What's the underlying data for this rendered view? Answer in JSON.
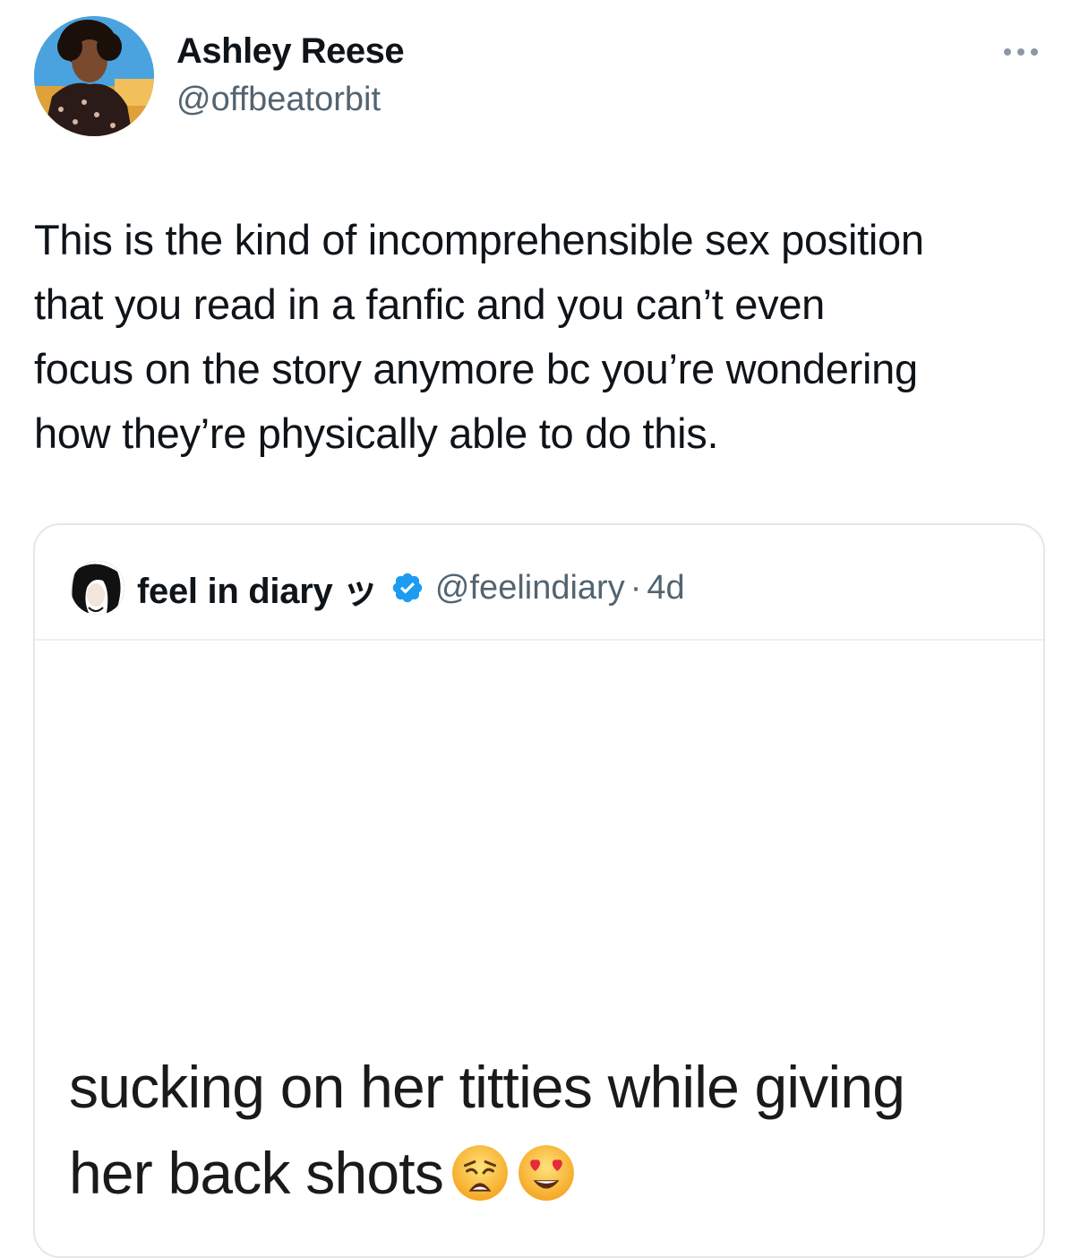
{
  "tweet": {
    "author": {
      "display_name": "Ashley Reese",
      "handle": "@offbeatorbit",
      "avatar_icon": "profile-photo"
    },
    "more_icon": "more-horizontal-icon",
    "text": "This is the kind of incomprehensible sex position\nthat you read in a fanfic and you can’t even\nfocus on the story anymore bc you’re wondering\nhow they’re physically able to do this."
  },
  "quoted": {
    "author": {
      "display_name": "feel in diary ッ",
      "handle": "@feelindiary",
      "separator": "·",
      "time": "4d",
      "verified_icon": "verified-badge-icon",
      "verified_color": "#1d9bf0"
    },
    "media_text": "sucking on her titties while giving\nher back shots",
    "emojis": [
      "weary-face-emoji",
      "heart-eyes-emoji"
    ]
  },
  "colors": {
    "text_primary": "#0f1419",
    "text_secondary": "#536471",
    "border": "#e1e8ed"
  }
}
